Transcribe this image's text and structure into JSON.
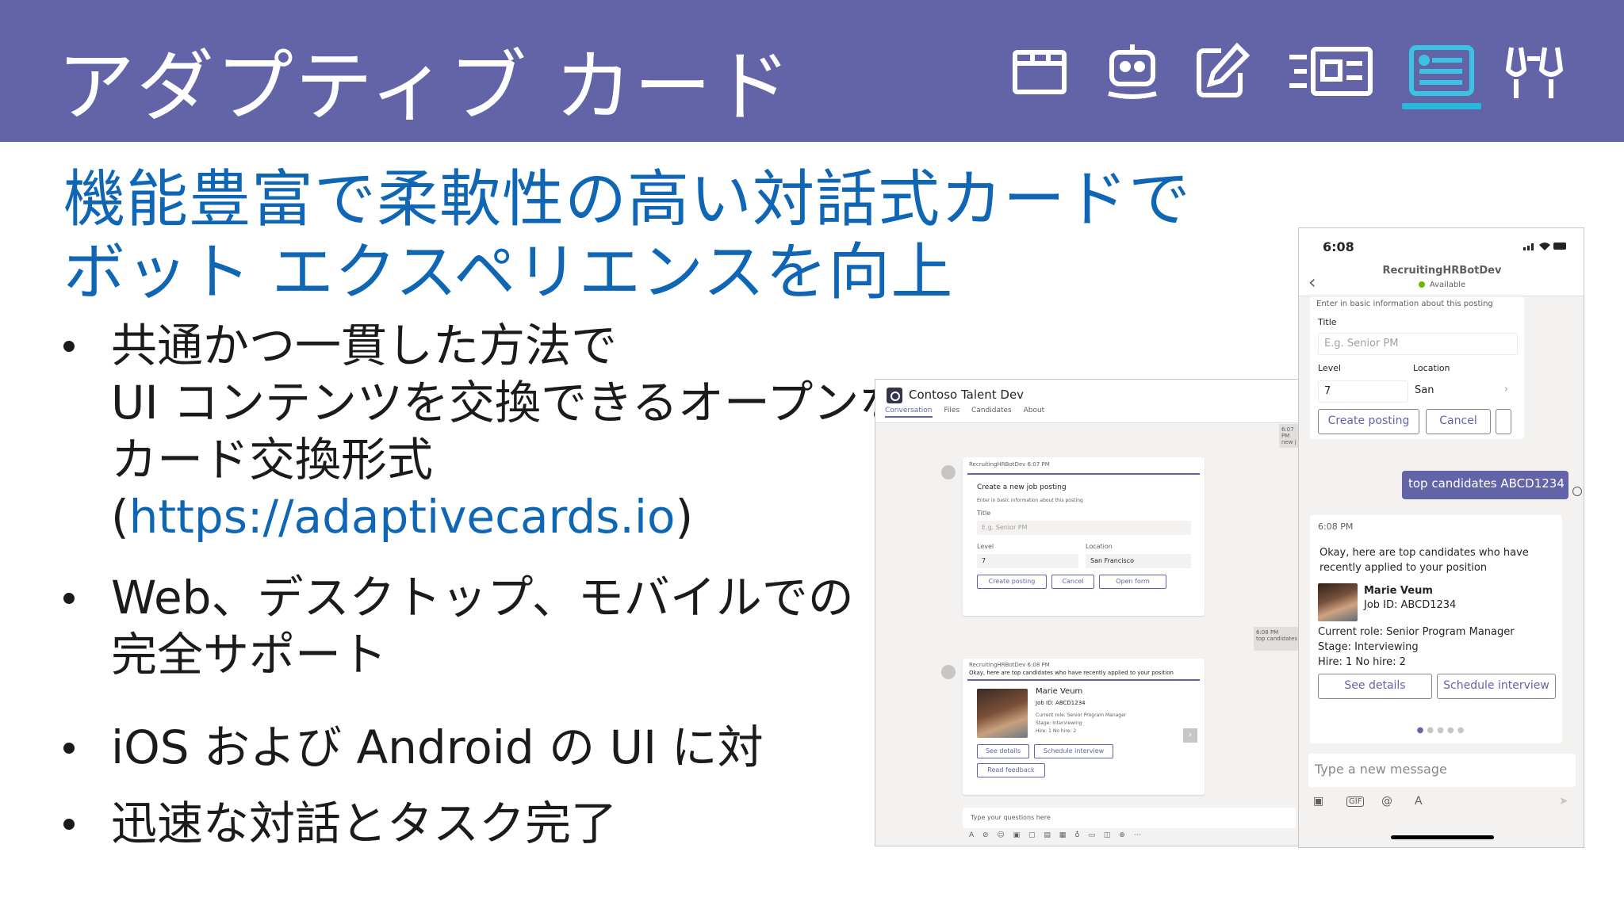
{
  "slide": {
    "title": "アダプティブ カード",
    "header_icons": [
      {
        "name": "tab-icon",
        "active": false
      },
      {
        "name": "bot-icon",
        "active": false
      },
      {
        "name": "edit-icon",
        "active": false
      },
      {
        "name": "message-extension-icon",
        "active": false
      },
      {
        "name": "adaptive-card-icon",
        "active": true
      },
      {
        "name": "connector-icon",
        "active": false
      }
    ],
    "accent_color": "#6264a7",
    "subtitle_lines": [
      "機能豊富で柔軟性の高い対話式カードで",
      "ボット エクスペリエンスを向上"
    ],
    "bullets": [
      {
        "lines": [
          "共通かつ一貫した方法で",
          "UI コンテンツを交換できるオープンな",
          "カード交換形式"
        ],
        "link_prefix": "(",
        "link": "https://adaptivecards.io",
        "link_suffix": ")"
      },
      {
        "lines": [
          "Web、デスクトップ、モバイルでの",
          "完全サポート"
        ]
      },
      {
        "lines": [
          " iOS および Android の UI に対"
        ]
      },
      {
        "lines": [
          "迅速な対話とタスク完了"
        ]
      }
    ]
  },
  "desktop": {
    "app_name": "Contoso Talent Dev",
    "tabs": [
      "Conversation",
      "Files",
      "Candidates",
      "About"
    ],
    "time_stamp_1": "6:07 PM",
    "time_stamp_1_b": "new j",
    "card1": {
      "sender": "RecruitingHRBotDev  6:07 PM",
      "heading": "Create a new job posting",
      "hint": "Enter in basic information about this posting",
      "title_label": "Title",
      "title_placeholder": "E.g. Senior PM",
      "level_label": "Level",
      "location_label": "Location",
      "level_value": "7",
      "location_value": "San Francisco",
      "buttons": [
        "Create posting",
        "Cancel",
        "Open form"
      ]
    },
    "time_stamp_2": "6:08 PM",
    "time_stamp_2_b": "top candidates",
    "card2": {
      "sender": "RecruitingHRBotDev  6:08 PM",
      "heading": "Okay, here are top candidates who have recently applied to your position",
      "name": "Marie Veum",
      "job_id": "Job ID: ABCD1234",
      "role": "Current role: Senior Program Manager",
      "stage": "Stage: Interviewing",
      "hire": "Hire: 1 No hire: 2",
      "buttons": [
        "See details",
        "Schedule interview",
        "Read feedback"
      ]
    },
    "compose_placeholder": "Type your questions here"
  },
  "mobile": {
    "time": "6:08",
    "bot_name": "RecruitingHRBotDev",
    "status": "Available",
    "card1": {
      "hint": "Enter in basic information about this posting",
      "title_label": "Title",
      "title_placeholder": "E.g. Senior PM",
      "level_label": "Level",
      "location_label": "Location",
      "level_value": "7",
      "location_value": "San",
      "buttons": [
        "Create posting",
        "Cancel"
      ]
    },
    "user_message": "top candidates ABCD1234",
    "card2": {
      "time": "6:08 PM",
      "intro": [
        "Okay, here are top candidates who have",
        "recently applied to your position"
      ],
      "name": "Marie Veum",
      "job_id": "Job ID: ABCD1234",
      "role": "Current role: Senior Program Manager",
      "stage": "Stage: Interviewing",
      "hire": "Hire: 1 No hire: 2",
      "buttons": [
        "See details",
        "Schedule interview"
      ]
    },
    "compose_placeholder": "Type a new message",
    "tools": [
      "image-icon",
      "gif-icon",
      "mention-icon",
      "format-icon",
      "send-icon"
    ]
  }
}
